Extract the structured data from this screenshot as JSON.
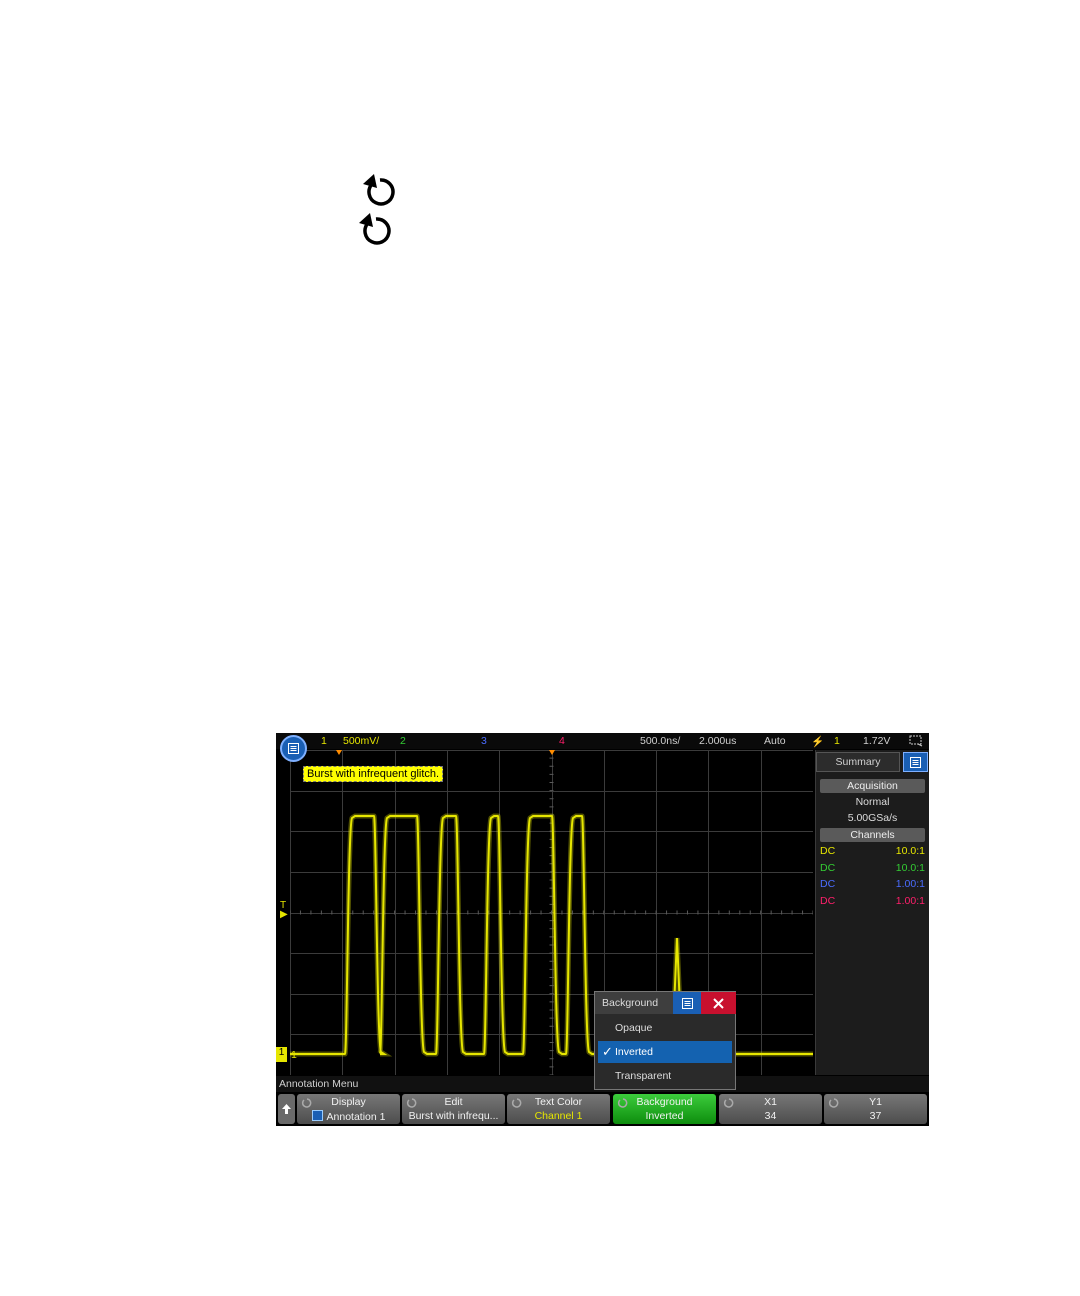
{
  "knob_icons": [
    "rotate-knob-icon",
    "rotate-knob-icon"
  ],
  "scope": {
    "topbar": {
      "ch1_num": "1",
      "ch1_scale": "500mV/",
      "ch2_num": "2",
      "ch3_num": "3",
      "ch4_num": "4",
      "timebase": "500.0ns/",
      "delay": "2.000us",
      "trigger_mode": "Auto",
      "trigger_source": "1",
      "trigger_level": "1.72V"
    },
    "annotation_text": "Burst with infrequent glitch.",
    "trigger_marker": "T",
    "ch1_ground_label": "1",
    "side_panel": {
      "tab_label": "Summary",
      "acquisition_header": "Acquisition",
      "acq_mode": "Normal",
      "sample_rate": "5.00GSa/s",
      "channels_header": "Channels",
      "channels": [
        {
          "coupling": "DC",
          "probe": "10.0:1",
          "color": "#e6e600"
        },
        {
          "coupling": "DC",
          "probe": "10.0:1",
          "color": "#33cc33"
        },
        {
          "coupling": "DC",
          "probe": "1.00:1",
          "color": "#4a6cff"
        },
        {
          "coupling": "DC",
          "probe": "1.00:1",
          "color": "#ff1f6b"
        }
      ]
    },
    "popup": {
      "title": "Background",
      "options": [
        "Opaque",
        "Inverted",
        "Transparent"
      ],
      "selected": "Inverted"
    },
    "menu_title": "Annotation Menu",
    "softkeys": [
      {
        "label": "Display",
        "value": "Annotation 1"
      },
      {
        "label": "Edit",
        "value": "Burst with infrequ..."
      },
      {
        "label": "Text Color",
        "value": "Channel 1"
      },
      {
        "label": "Background",
        "value": "Inverted"
      },
      {
        "label": "X1",
        "value": "34"
      },
      {
        "label": "Y1",
        "value": "37"
      }
    ],
    "colors": {
      "ch1": "#e6e600",
      "ch2": "#33cc33",
      "ch3": "#4a6cff",
      "ch4": "#ff1f6b",
      "accent": "#1a5fb4"
    }
  }
}
